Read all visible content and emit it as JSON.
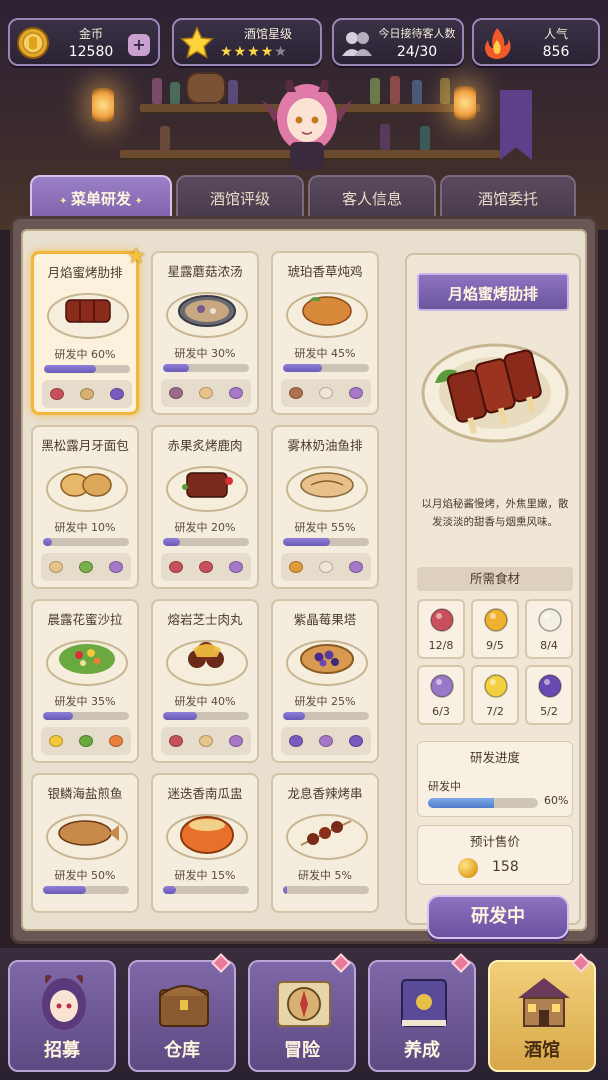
{
  "resources": {
    "gold": {
      "label": "金币",
      "value": "12580",
      "plus": "+"
    },
    "rating": {
      "label": "酒馆星级",
      "stars_filled": 4,
      "stars_total": 5
    },
    "guests": {
      "label": "今日接待客人数",
      "value": "24/30"
    },
    "popularity": {
      "label": "人气",
      "value": "856"
    }
  },
  "tabs": [
    {
      "label": "菜单研发",
      "active": true
    },
    {
      "label": "酒馆评级",
      "active": false
    },
    {
      "label": "客人信息",
      "active": false
    },
    {
      "label": "酒馆委托",
      "active": false
    }
  ],
  "recipes": [
    {
      "name": "月焰蜜烤肋排",
      "status": "研发中 60%",
      "progress": 0.6,
      "selected": true,
      "food": "ribs",
      "ingredients": [
        "meat",
        "potato",
        "berry"
      ]
    },
    {
      "name": "星露蘑菇浓汤",
      "status": "研发中 30%",
      "progress": 0.3,
      "selected": false,
      "food": "soup",
      "ingredients": [
        "mushroom-purple",
        "bread",
        "herb"
      ]
    },
    {
      "name": "琥珀香草炖鸡",
      "status": "研发中 45%",
      "progress": 0.45,
      "selected": false,
      "food": "chicken",
      "ingredients": [
        "mushroom",
        "garlic",
        "herb"
      ]
    },
    {
      "name": "黑松露月牙面包",
      "status": "研发中 10%",
      "progress": 0.1,
      "selected": false,
      "food": "bread",
      "ingredients": [
        "bread",
        "sprout",
        "herb"
      ]
    },
    {
      "name": "赤果炙烤鹿肉",
      "status": "研发中 20%",
      "progress": 0.2,
      "selected": false,
      "food": "venison",
      "ingredients": [
        "meat",
        "meat",
        "herb"
      ]
    },
    {
      "name": "雾林奶油鱼排",
      "status": "研发中 55%",
      "progress": 0.55,
      "selected": false,
      "food": "fish",
      "ingredients": [
        "herb-orange",
        "garlic",
        "herb"
      ]
    },
    {
      "name": "晨露花蜜沙拉",
      "status": "研发中 35%",
      "progress": 0.35,
      "selected": false,
      "food": "salad",
      "ingredients": [
        "flower",
        "leaf",
        "carrot"
      ]
    },
    {
      "name": "熔岩芝士肉丸",
      "status": "研发中 40%",
      "progress": 0.4,
      "selected": false,
      "food": "meatball",
      "ingredients": [
        "meat",
        "bread",
        "herb"
      ]
    },
    {
      "name": "紫晶莓果塔",
      "status": "研发中 25%",
      "progress": 0.25,
      "selected": false,
      "food": "tart",
      "ingredients": [
        "berry",
        "herb",
        "berry"
      ]
    },
    {
      "name": "银鳞海盐煎鱼",
      "status": "研发中 50%",
      "progress": 0.5,
      "selected": false,
      "food": "fish-fried",
      "ingredients": []
    },
    {
      "name": "迷迭香南瓜盅",
      "status": "研发中 15%",
      "progress": 0.15,
      "selected": false,
      "food": "pumpkin",
      "ingredients": []
    },
    {
      "name": "龙息香辣烤串",
      "status": "研发中 5%",
      "progress": 0.05,
      "selected": false,
      "food": "skewer",
      "ingredients": []
    }
  ],
  "detail": {
    "title": "月焰蜜烤肋排",
    "description": "以月焰秘酱慢烤，外焦里嫩，散发淡淡的甜香与烟熏风味。",
    "ingredients_header": "所需食材",
    "ingredients": [
      {
        "icon": "meat-icon",
        "count": "12/8",
        "color": "#c8505a"
      },
      {
        "icon": "honey-icon",
        "count": "9/5",
        "color": "#f0b030"
      },
      {
        "icon": "garlic-icon",
        "count": "8/4",
        "color": "#f4efe4"
      },
      {
        "icon": "lavender-icon",
        "count": "6/3",
        "color": "#9a78c8"
      },
      {
        "icon": "yellow-flower-icon",
        "count": "7/2",
        "color": "#f2d040"
      },
      {
        "icon": "berry-icon",
        "count": "5/2",
        "color": "#6a4ab0"
      }
    ],
    "progress_header": "研发进度",
    "progress_label": "研发中",
    "progress_value": 0.6,
    "progress_text": "60%",
    "price_header": "预计售价",
    "price_value": "158",
    "button_label": "研发中"
  },
  "nav": [
    {
      "label": "招募",
      "icon": "demon-girl-icon",
      "active": false,
      "badge": false
    },
    {
      "label": "仓库",
      "icon": "chest-icon",
      "active": false,
      "badge": true
    },
    {
      "label": "冒险",
      "icon": "compass-map-icon",
      "active": false,
      "badge": true
    },
    {
      "label": "养成",
      "icon": "book-icon",
      "active": false,
      "badge": true
    },
    {
      "label": "酒馆",
      "icon": "tavern-icon",
      "active": true,
      "badge": true
    }
  ],
  "colors": {
    "accent_purple": "#7d62a8",
    "gold": "#f2b63c",
    "parchment": "#e9dfcf",
    "progress_blue": "#4f7ec8"
  }
}
